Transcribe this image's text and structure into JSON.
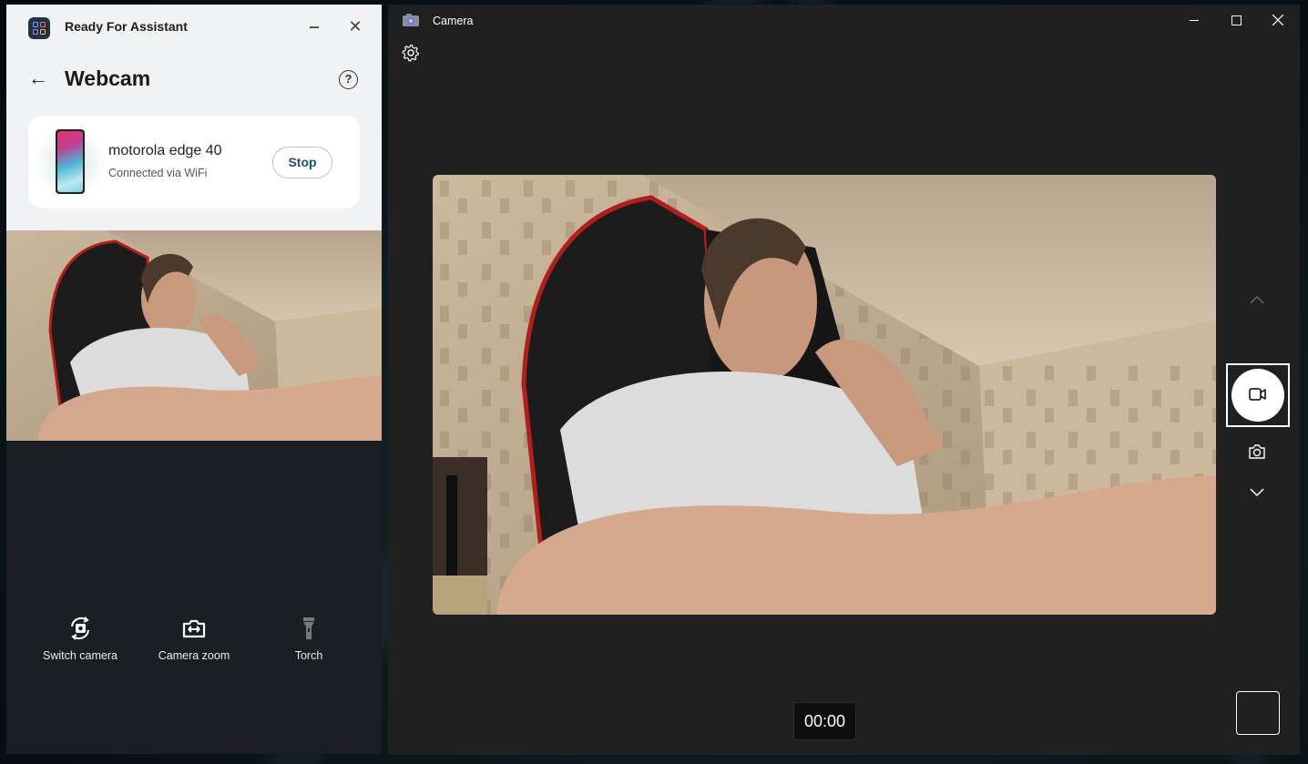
{
  "assistant_window": {
    "title": "Ready For Assistant",
    "page_title": "Webcam",
    "device": {
      "name": "motorola edge 40",
      "status": "Connected via WiFi",
      "stop_label": "Stop"
    },
    "controls": [
      {
        "label": "Switch camera",
        "icon": "switch-camera-icon",
        "enabled": true
      },
      {
        "label": "Camera zoom",
        "icon": "camera-zoom-icon",
        "enabled": true
      },
      {
        "label": "Torch",
        "icon": "torch-icon",
        "enabled": false
      }
    ]
  },
  "camera_window": {
    "title": "Camera",
    "mode": "video",
    "timer": "00:00"
  }
}
